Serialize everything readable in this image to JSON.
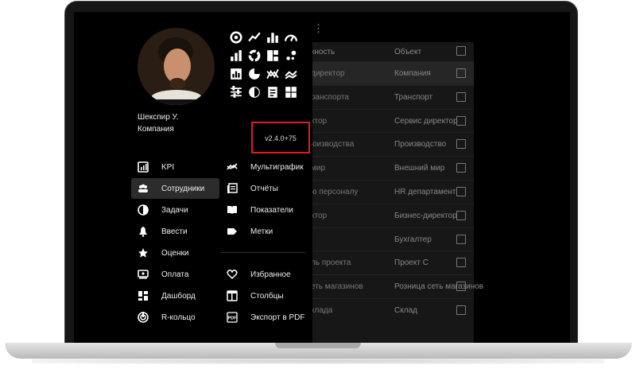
{
  "version": "v2.4.0+75",
  "user": {
    "name": "Шекспир У.",
    "company": "Компания"
  },
  "table": {
    "columns": [
      "кность",
      "Объект"
    ],
    "rows": [
      {
        "role": "директор",
        "object": "Компания",
        "highlight": true
      },
      {
        "role": "ранспорта",
        "object": "Транспорт"
      },
      {
        "role": "ктор",
        "object": "Сервис директор"
      },
      {
        "role": "юизводства",
        "object": "Производство"
      },
      {
        "role": "мир",
        "object": "Внешний мир"
      },
      {
        "role": "ю персоналу",
        "object": "HR департамент"
      },
      {
        "role": "ктор",
        "object": "Бизнес-директор"
      },
      {
        "role": "",
        "object": "Бухгалтер"
      },
      {
        "role": "ль проекта",
        "object": "Проект С"
      },
      {
        "role": "еть магазинов",
        "object": "Розница сеть магазинов"
      },
      {
        "role": "клада",
        "object": "Склад"
      }
    ]
  },
  "menu_left": [
    {
      "label": "KPI",
      "icon": "kpi-icon"
    },
    {
      "label": "Сотрудники",
      "icon": "people-icon",
      "active": true
    },
    {
      "label": "Задачи",
      "icon": "tasks-icon"
    },
    {
      "label": "Ввести",
      "icon": "bell-icon"
    },
    {
      "label": "Оценки",
      "icon": "star-icon"
    },
    {
      "label": "Оплата",
      "icon": "payment-icon"
    },
    {
      "label": "Дашборд",
      "icon": "dashboard-icon"
    },
    {
      "label": "R-кольцо",
      "icon": "ring-icon"
    }
  ],
  "menu_right": [
    {
      "label": "Мультиграфик",
      "icon": "multichart-icon"
    },
    {
      "label": "Отчёты",
      "icon": "reports-icon"
    },
    {
      "label": "Показатели",
      "icon": "book-icon"
    },
    {
      "label": "Метки",
      "icon": "tag-icon"
    },
    {
      "label": "Избранное",
      "icon": "heart-icon"
    },
    {
      "label": "Столбцы",
      "icon": "columns-icon"
    },
    {
      "label": "Экспорт в PDF",
      "icon": "pdf-icon"
    }
  ],
  "grid_icons": [
    "ring-chart-icon",
    "line-chart-icon",
    "bar-chart-icon",
    "gauge-icon",
    "bar-chart-2-icon",
    "donut-icon",
    "blocks-icon",
    "scatter-icon",
    "kpi-chart-icon",
    "pie-icon",
    "multi-line-icon",
    "trend-icon",
    "sliders-icon",
    "half-circle-icon",
    "report-icon",
    "grid-icon"
  ],
  "colors": {
    "highlight_border": "#e11b1b",
    "background": "#000000",
    "table_bg": "#171717"
  }
}
